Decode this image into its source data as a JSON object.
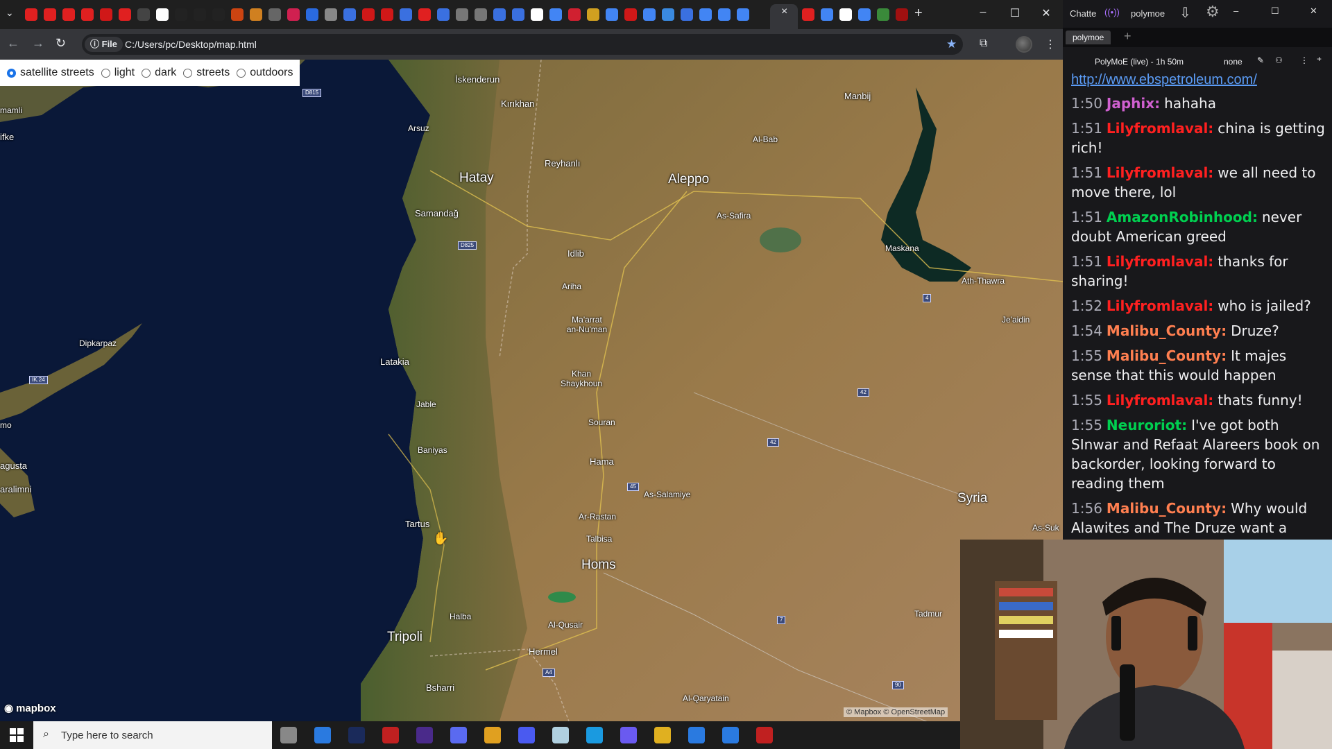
{
  "browser": {
    "url": "C:/Users/pc/Desktop/map.html",
    "site_chip": "File",
    "tab_close": "×",
    "new_tab": "+"
  },
  "map": {
    "style_options": [
      {
        "label": "satellite streets",
        "selected": true
      },
      {
        "label": "light",
        "selected": false
      },
      {
        "label": "dark",
        "selected": false
      },
      {
        "label": "streets",
        "selected": false
      },
      {
        "label": "outdoors",
        "selected": false
      }
    ],
    "places": {
      "iskenderun": "İskenderun",
      "kirikhan": "Kırıkhan",
      "arsuz": "Arsuz",
      "hatay": "Hatay",
      "reyhanli": "Reyhanlı",
      "aleppo": "Aleppo",
      "manbij": "Manbij",
      "al_bab": "Al-Bab",
      "samandag": "Samandağ",
      "as_safira": "As-Safira",
      "idlib": "Idlib",
      "ariha": "Ariha",
      "maskana": "Maskana",
      "ath_thawra": "Ath-Thawra",
      "maarrat": "Ma'arrat an-Nu'man",
      "dipkarpaz": "Dipkarpaz",
      "latakia": "Latakia",
      "khan_shaykhoun": "Khan Shaykhoun",
      "jable": "Jable",
      "souran": "Souran",
      "baniyas": "Baniyas",
      "hama": "Hama",
      "as_salamiye": "As-Salamiye",
      "ar_rastan": "Ar-Rastan",
      "tartus": "Tartus",
      "talbisa": "Talbisa",
      "homs": "Homs",
      "syria": "Syria",
      "halba": "Halba",
      "al_qusayr": "Al-Qusair",
      "tripoli": "Tripoli",
      "hermel": "Hermel",
      "tadmur": "Tadmur",
      "bsharri": "Bsharri",
      "al_qaryatain": "Al-Qaryatain",
      "famagusta": "agusta",
      "paralimni": "aralimni",
      "ifke": "ifke",
      "mamli": "mamli",
      "mo": "mo",
      "jiedin": "Je'aidin",
      "as_suk": "As-Suk"
    },
    "shields": {
      "d815": "D815",
      "d825": "D825",
      "ik24": "IK.24",
      "r42a": "42",
      "r42b": "42",
      "r45": "45",
      "r4": "4",
      "r7": "7",
      "r90": "90",
      "a4": "A4"
    },
    "logo_text": "mapbox",
    "attribution": "© Mapbox © OpenStreetMap"
  },
  "chat": {
    "window_title": "Chatte",
    "channel_title": "polymoe",
    "tab_label": "polymoe",
    "header_stream": "PolyMoE (live) - 1h 50m",
    "header_filter": "none",
    "link": "http://www.ebspetroleum.com/",
    "messages": [
      {
        "time": "1:50",
        "user": "Japhix:",
        "color": "#d060d0",
        "text": "hahaha"
      },
      {
        "time": "1:51",
        "user": "Lilyfromlaval:",
        "color": "#ff2020",
        "text": "china is getting rich!"
      },
      {
        "time": "1:51",
        "user": "Lilyfromlaval:",
        "color": "#ff2020",
        "text": "we all need to move there, lol"
      },
      {
        "time": "1:51",
        "user": "AmazonRobinhood:",
        "color": "#00d050",
        "text": "never doubt American greed"
      },
      {
        "time": "1:51",
        "user": "Lilyfromlaval:",
        "color": "#ff2020",
        "text": "thanks for sharing!"
      },
      {
        "time": "1:52",
        "user": "Lilyfromlaval:",
        "color": "#ff2020",
        "text": "who is jailed?"
      },
      {
        "time": "1:54",
        "user": "Malibu_County:",
        "color": "#ff7f50",
        "text": "Druze?"
      },
      {
        "time": "1:55",
        "user": "Malibu_County:",
        "color": "#ff7f50",
        "text": "It majes sense that this would happen"
      },
      {
        "time": "1:55",
        "user": "Lilyfromlaval:",
        "color": "#ff2020",
        "text": "thats funny!"
      },
      {
        "time": "1:55",
        "user": "Neuroriot:",
        "color": "#00d050",
        "text": "I've got both SInwar and Refaat Alareers book on backorder, looking forward to reading them"
      },
      {
        "time": "1:56",
        "user": "Malibu_County:",
        "color": "#ff7f50",
        "text": "Why would Alawites and The Druze want a state with HTS leaders?"
      }
    ]
  },
  "taskbar": {
    "search_placeholder": "Type here to search"
  }
}
